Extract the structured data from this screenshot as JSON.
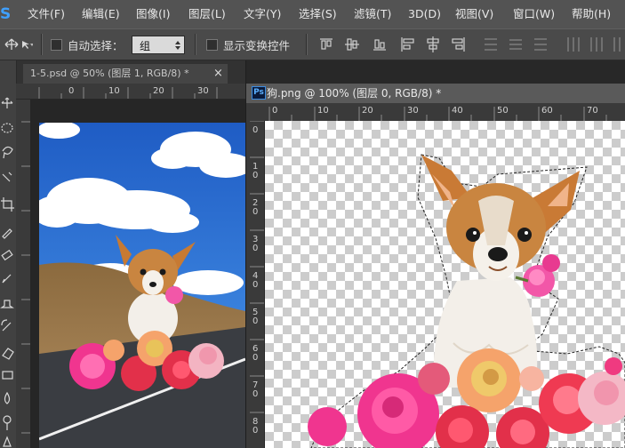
{
  "app": {
    "logo_letter": "S",
    "logo_color": "#3fa0ff"
  },
  "menu": {
    "items": [
      "文件(F)",
      "编辑(E)",
      "图像(I)",
      "图层(L)",
      "文字(Y)",
      "选择(S)",
      "滤镜(T)",
      "3D(D)",
      "视图(V)",
      "窗口(W)",
      "帮助(H)"
    ]
  },
  "options": {
    "auto_select_label": "自动选择：",
    "auto_select_value": "组",
    "show_transform_label": "显示变换控件",
    "auto_select_checked": false,
    "show_transform_checked": false
  },
  "documents": {
    "doc1_tab": "1-5.psd @ 50% (图层 1, RGB/8) *",
    "doc1_close": "×",
    "doc2_tab": "狗.png @ 100% (图层 0, RGB/8) *",
    "doc2_badge": "Ps"
  },
  "rulers": {
    "doc1_top": [
      "0",
      "10",
      "20",
      "30"
    ],
    "doc2_top": [
      "0",
      "10",
      "20",
      "30",
      "40",
      "50",
      "60",
      "70"
    ],
    "doc2_left": [
      "0",
      "1\n0",
      "2\n0",
      "3\n0",
      "4\n0",
      "5\n0",
      "6\n0",
      "7\n0",
      "8\n0"
    ]
  },
  "icons": {
    "move_tool": "move-icon",
    "tools": [
      "move-icon",
      "marquee-icon",
      "lasso-icon",
      "quick-select-icon",
      "crop-icon",
      "eyedropper-icon",
      "healing-icon",
      "brush-icon",
      "stamp-icon",
      "history-brush-icon",
      "eraser-icon",
      "gradient-icon",
      "blur-icon",
      "dodge-icon",
      "pen-icon"
    ]
  },
  "colors": {
    "menu_bg": "#535353",
    "panel_bg": "#4a4a4a",
    "sky": "#2f6fd1",
    "fur": "#c77a33",
    "rose_pink": "#f0358f",
    "rose_red": "#e2304a",
    "road": "#3a3d42"
  }
}
